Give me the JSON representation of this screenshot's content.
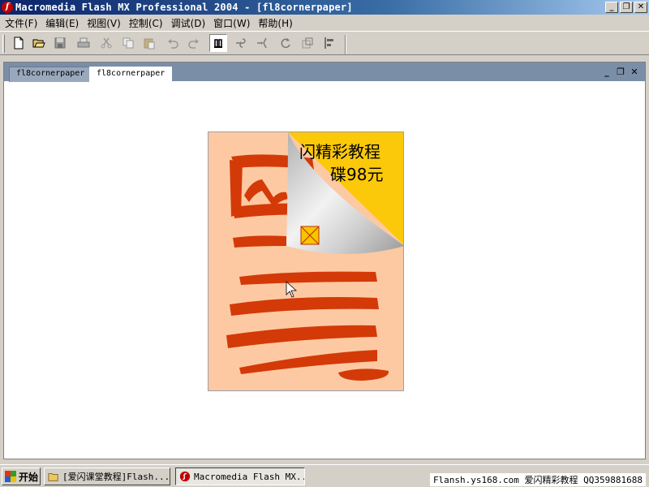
{
  "window": {
    "title": "Macromedia Flash MX Professional 2004 - [fl8cornerpaper]",
    "app_icon": "flash-icon"
  },
  "menu": [
    {
      "label": "文件(F)"
    },
    {
      "label": "编辑(E)"
    },
    {
      "label": "视图(V)"
    },
    {
      "label": "控制(C)"
    },
    {
      "label": "调试(D)"
    },
    {
      "label": "窗口(W)"
    },
    {
      "label": "帮助(H)"
    }
  ],
  "toolbar": {
    "buttons": [
      "new-file-icon",
      "open-folder-icon",
      "save-icon",
      "print-icon",
      "cut-icon",
      "copy-icon",
      "paste-icon",
      "undo-icon",
      "redo-icon",
      "snap-icon",
      "smooth-icon",
      "straighten-icon",
      "rotate-icon",
      "scale-icon",
      "align-icon"
    ]
  },
  "document": {
    "tabs": [
      {
        "label": "fl8cornerpaper",
        "active": false
      },
      {
        "label": "fl8cornerpaper",
        "active": true
      }
    ]
  },
  "stage": {
    "banner_line1": "闪精彩教程",
    "banner_line2": "碟98元",
    "background_color": "#fdc9a2",
    "brush_color": "#d33a08",
    "corner_color": "#fbc90a"
  },
  "taskbar": {
    "start_label": "开始",
    "tasks": [
      {
        "label": "[爱闪课堂教程]Flash...",
        "icon": "folder-icon",
        "active": false
      },
      {
        "label": "Macromedia Flash MX...",
        "icon": "flash-icon",
        "active": true
      }
    ],
    "caption": "Flansh.ys168.com 爱闪精彩教程 QQ359881688"
  }
}
